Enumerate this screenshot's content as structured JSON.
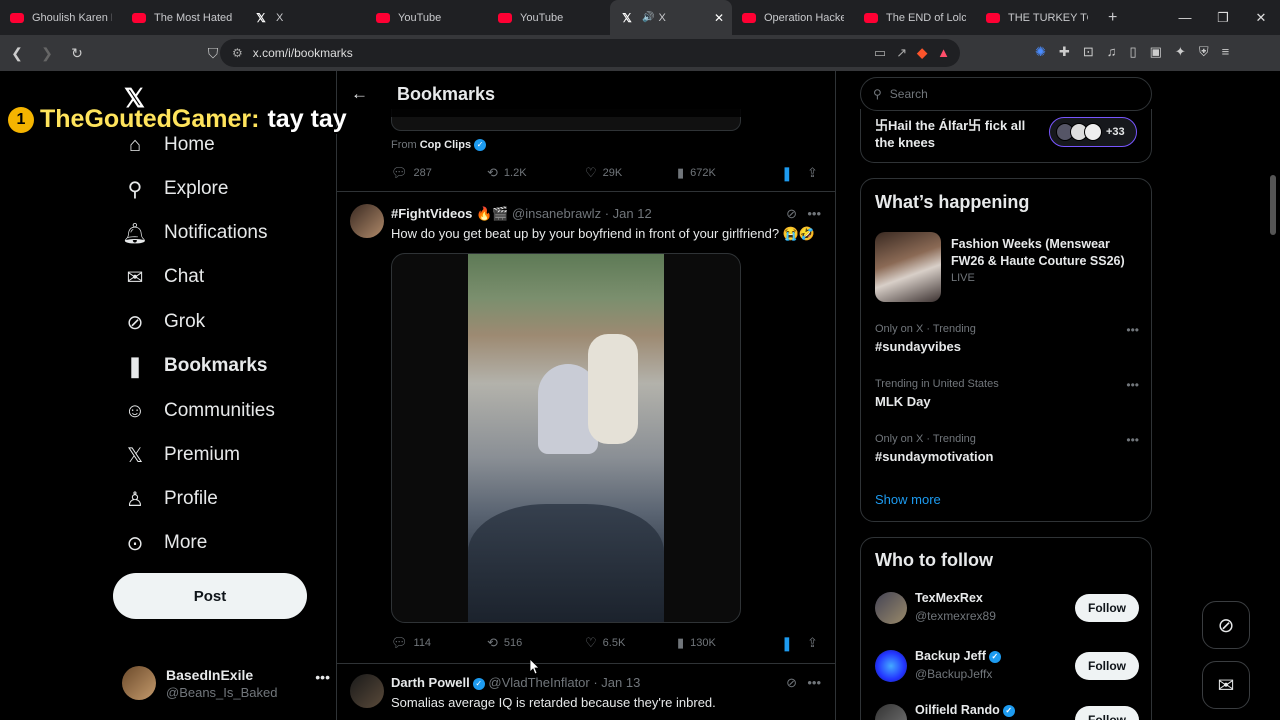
{
  "browser": {
    "tabs": [
      {
        "title": "Ghoulish Karen Ha",
        "favicon": "youtube-icon"
      },
      {
        "title": "The Most Hated W",
        "favicon": "youtube-icon"
      },
      {
        "title": "X",
        "favicon": "x-icon"
      },
      {
        "title": "YouTube",
        "favicon": "youtube-icon"
      },
      {
        "title": "YouTube",
        "favicon": "youtube-icon"
      },
      {
        "title": "X",
        "favicon": "x-icon",
        "active": true
      },
      {
        "title": "Operation Hacker",
        "favicon": "youtube-icon"
      },
      {
        "title": "The END of Lolcow",
        "favicon": "youtube-icon"
      },
      {
        "title": "THE TURKEY TOM",
        "favicon": "youtube-icon"
      }
    ],
    "new_tab": "+",
    "url": "x.com/i/bookmarks"
  },
  "overlay": {
    "badge": "1",
    "user": "TheGoutedGamer:",
    "message": "tay tay"
  },
  "nav": {
    "items": [
      {
        "label": "Home",
        "icon": "home-icon"
      },
      {
        "label": "Explore",
        "icon": "search-icon"
      },
      {
        "label": "Notifications",
        "icon": "bell-icon"
      },
      {
        "label": "Chat",
        "icon": "mail-icon"
      },
      {
        "label": "Grok",
        "icon": "grok-icon"
      },
      {
        "label": "Bookmarks",
        "icon": "bookmark-icon"
      },
      {
        "label": "Communities",
        "icon": "people-icon"
      },
      {
        "label": "Premium",
        "icon": "x-icon"
      },
      {
        "label": "Profile",
        "icon": "person-icon"
      },
      {
        "label": "More",
        "icon": "more-circle-icon"
      }
    ],
    "post": "Post",
    "account": {
      "name": "BasedInExile",
      "handle": "@Beans_Is_Baked"
    }
  },
  "header": {
    "title": "Bookmarks"
  },
  "prev_tweet": {
    "from_label": "From",
    "from_name": "Cop Clips",
    "replies": "287",
    "reposts": "1.2K",
    "likes": "29K",
    "views": "672K"
  },
  "tweet1": {
    "name": "#FightVideos 🔥🎬",
    "handle": "@insanebrawlz",
    "date": "· Jan 12",
    "text": "How do you get beat up by your boyfriend in front of your girlfriend? 😭🤣",
    "replies": "114",
    "reposts": "516",
    "likes": "6.5K",
    "views": "130K"
  },
  "tweet2": {
    "name": "Darth Powell",
    "handle": "@VladTheInflator",
    "date": "· Jan 13",
    "text": "Somalias average IQ is retarded because they're inbred."
  },
  "right": {
    "search_placeholder": "Search",
    "prev_trend": "卐Hail the Álfar卐 fick all the knees",
    "prev_trend_count": "+33",
    "happening": {
      "title": "What’s happening",
      "featured_title": "Fashion Weeks (Menswear FW26 & Haute Couture SS26)",
      "featured_status": "LIVE",
      "trends": [
        {
          "meta": "Only on X · Trending",
          "title": "#sundayvibes"
        },
        {
          "meta": "Trending in United States",
          "title": "MLK Day"
        },
        {
          "meta": "Only on X · Trending",
          "title": "#sundaymotivation"
        }
      ],
      "show_more": "Show more"
    },
    "who": {
      "title": "Who to follow",
      "people": [
        {
          "name": "TexMexRex",
          "handle": "@texmexrex89",
          "button": "Follow"
        },
        {
          "name": "Backup Jeff",
          "handle": "@BackupJeffx",
          "button": "Follow"
        },
        {
          "name": "Oilfield Rando",
          "handle": "",
          "button": "Follow"
        }
      ]
    }
  },
  "colors": {
    "accent": "#1d9bf0",
    "background": "#000000",
    "border": "#2f3336",
    "muted": "#71767b"
  }
}
